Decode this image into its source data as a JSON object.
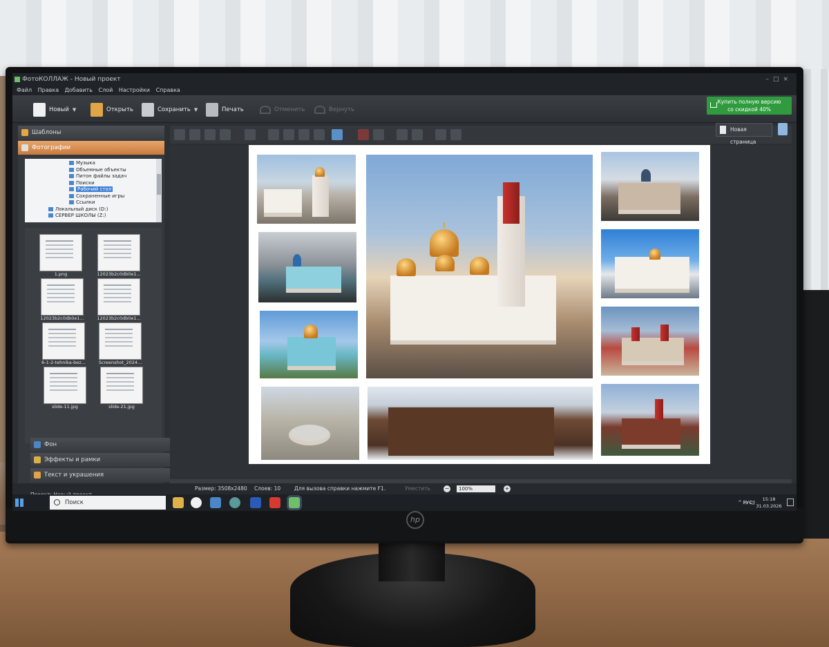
{
  "window": {
    "title": "ФотоКОЛЛАЖ - Новый проект"
  },
  "menu": [
    "Файл",
    "Правка",
    "Добавить",
    "Слой",
    "Настройки",
    "Справка"
  ],
  "toolbar": {
    "new": "Новый",
    "open": "Открыть",
    "save": "Сохранить",
    "print": "Печать",
    "undo": "Отменить",
    "redo": "Вернуть",
    "buy_line1": "Купить полную версию",
    "buy_line2": "со скидкой 40%"
  },
  "left_panel": {
    "templates": "Шаблоны",
    "photos": "Фотографии",
    "tree": [
      {
        "label": "Музыка",
        "selected": false
      },
      {
        "label": "Объемные объекты",
        "selected": false
      },
      {
        "label": "Питон файлы задач",
        "selected": false
      },
      {
        "label": "Поиски",
        "selected": false
      },
      {
        "label": "Рабочий стол",
        "selected": true
      },
      {
        "label": "Сохраненные игры",
        "selected": false
      },
      {
        "label": "Ссылки",
        "selected": false
      },
      {
        "label": "Локальный диск (D:)",
        "selected": false
      },
      {
        "label": "СЕРВЕР ШКОЛЫ (Z:)",
        "selected": false
      }
    ],
    "thumbnails": [
      "1.png",
      "12023b2c0db0e1...",
      "12023b2c0db0e1...",
      "12023b2c0db0e1...",
      "6-1-2-tehnika-bez...",
      "Screenshot_2024...",
      "slide-11.jpg",
      "slide-21.jpg"
    ],
    "background": "Фон",
    "effects": "Эффекты и рамки",
    "text": "Текст и украшения"
  },
  "canvas": {
    "new_page": "Новая страница"
  },
  "status": {
    "project": "Проект: Новый проект",
    "size": "Размер:  3508x2480",
    "layers": "Слоев:  10",
    "help": "Для вызова справки нажмите F1.",
    "fit": "Уместить",
    "zoom": "100%"
  },
  "taskbar": {
    "search_placeholder": "Поиск",
    "lang": "РУС",
    "time": "15:18",
    "date": "31.03.2026"
  },
  "device": {
    "brand": "hp"
  }
}
